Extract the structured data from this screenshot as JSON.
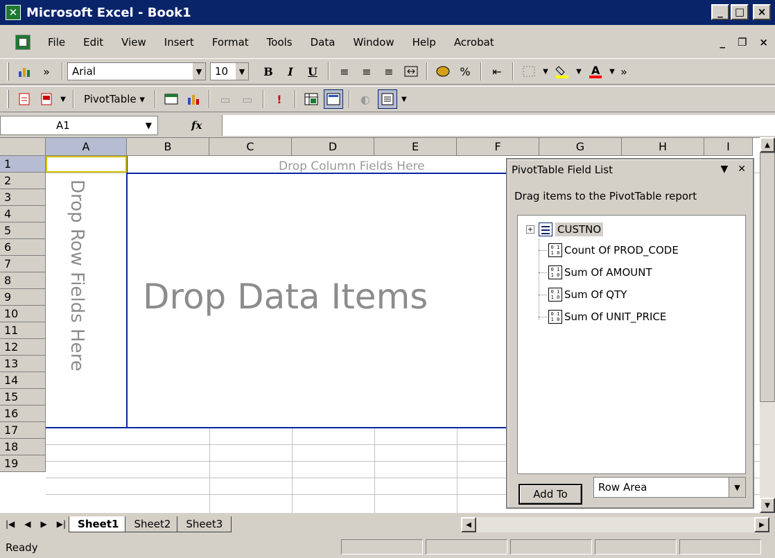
{
  "window": {
    "title": "Microsoft Excel - Book1",
    "min": "_",
    "restore": "□",
    "close": "×"
  },
  "menu": {
    "items": [
      "File",
      "Edit",
      "View",
      "Insert",
      "Format",
      "Tools",
      "Data",
      "Window",
      "Help",
      "Acrobat"
    ],
    "min": "_",
    "restore": "❐",
    "close": "×"
  },
  "toolbar1": {
    "font": "Arial",
    "size": "10",
    "bold": "B",
    "italic": "I",
    "underline": "U",
    "percent": "%",
    "more": "»"
  },
  "toolbar2": {
    "pivot_label": "PivotTable ▾",
    "exclaim": "!"
  },
  "formula": {
    "name_box": "A1",
    "fx": "fx",
    "value": ""
  },
  "grid": {
    "columns": [
      "A",
      "B",
      "C",
      "D",
      "E",
      "F",
      "G",
      "H",
      "I"
    ],
    "rows": [
      "1",
      "2",
      "3",
      "4",
      "5",
      "6",
      "7",
      "8",
      "9",
      "10",
      "11",
      "12",
      "13",
      "14",
      "15",
      "16",
      "17",
      "18",
      "19"
    ],
    "selected_cell": "A1",
    "drop_column": "Drop Column Fields Here",
    "drop_data": "Drop Data Items",
    "drop_row": "Drop Row Fields Here"
  },
  "sheets": {
    "tabs": [
      "Sheet1",
      "Sheet2",
      "Sheet3"
    ],
    "active": "Sheet1"
  },
  "status": {
    "text": "Ready"
  },
  "field_list": {
    "title": "PivotTable Field List",
    "instruction": "Drag items to the PivotTable report",
    "root": "CUSTNO",
    "fields": [
      "Count Of PROD_CODE",
      "Sum Of AMOUNT",
      "Sum Of QTY",
      "Sum Of UNIT_PRICE"
    ],
    "add_to": "Add To",
    "area": "Row Area"
  }
}
